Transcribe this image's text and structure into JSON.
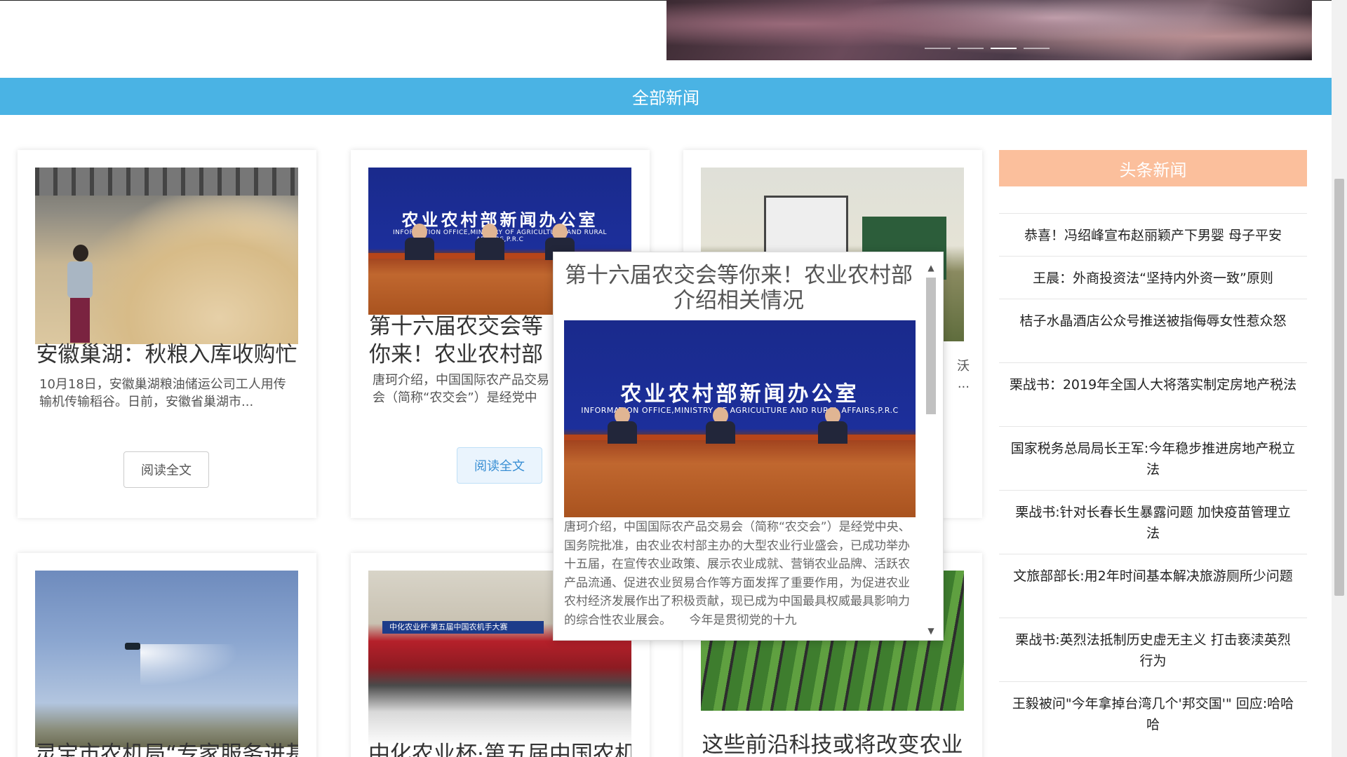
{
  "slider": {
    "dots": 4,
    "active_index": 2
  },
  "section": {
    "title": "全部新闻"
  },
  "cards": [
    {
      "title": "安徽巢湖：秋粮入库收购忙",
      "summary": "10月18日，安徽巢湖粮油储运公司工人用传输机传输稻谷。日前，安徽省巢湖市...",
      "button": "阅读全文"
    },
    {
      "title": "第十六届农交会等你来！农业农村部介绍相关情况",
      "summary": "唐珂介绍，中国国际农产品交易会（简称“农交会”）是经党中央、国务院批准...",
      "button": "阅读全文"
    },
    {
      "title": "",
      "summary": "沃 ...",
      "button": ""
    },
    {
      "title": "灵宝市农机局“专家服务进基"
    },
    {
      "title": "中化农业杯·第五届中国农机"
    },
    {
      "title": "这些前沿科技或将改变农业"
    }
  ],
  "press_image": {
    "heading": "农业农村部新闻办公室",
    "subheading": "INFORMATION OFFICE,MINISTRY OF AGRICULTURE AND RURAL AFFAIRS,P.R.C"
  },
  "hall_image": {
    "banner": "中化农业杯·第五届中国农机手大赛"
  },
  "popup": {
    "title": "第十六届农交会等你来！农业农村部介绍相关情况",
    "text": "唐珂介绍，中国国际农产品交易会（简称“农交会”）是经党中央、国务院批准，由农业农村部主办的大型农业行业盛会，已成功举办十五届，在宣传农业政策、展示农业成就、营销农业品牌、活跃农产品流通、促进农业贸易合作等方面发挥了重要作用，为促进农业农村经济发展作出了积极贡献，现已成为中国最具权威最具影响力的综合性农业展会。　　今年是贯彻党的十九"
  },
  "sidebar": {
    "title": "头条新闻",
    "items": [
      "恭喜！冯绍峰宣布赵丽颖产下男婴 母子平安",
      "王晨：外商投资法“坚持内外资一致”原则",
      "桔子水晶酒店公众号推送被指侮辱女性惹众怒",
      "栗战书：2019年全国人大将落实制定房地产税法",
      "国家税务总局局长王军:今年稳步推进房地产税立法",
      "栗战书:针对长春长生暴露问题 加快疫苗管理立法",
      "文旅部部长:用2年时间基本解决旅游厕所少问题",
      "栗战书:英烈法抵制历史虚无主义 打击亵渎英烈行为",
      "王毅被问\"今年拿掉台湾几个'邦交国'\" 回应:哈哈哈"
    ]
  },
  "icons": {
    "scroll_up": "chevron-up-icon",
    "scroll_down": "chevron-down-icon"
  },
  "colors": {
    "section_banner": "#4ab3e4",
    "sidebar_header": "#fbbf9c",
    "button_hover_bg": "#eaf4fd",
    "button_hover_text": "#3a8fd4"
  }
}
